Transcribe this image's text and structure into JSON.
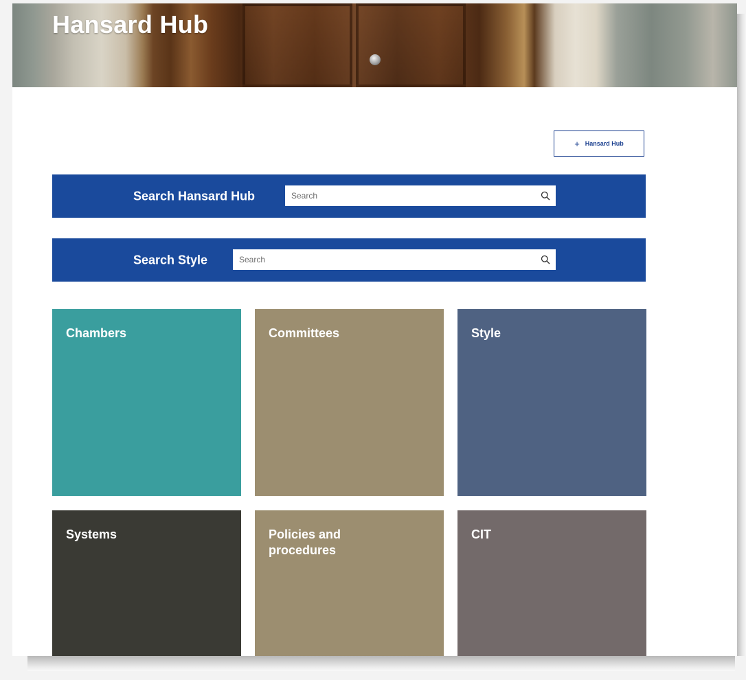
{
  "header": {
    "title": "Hansard Hub"
  },
  "toolbar": {
    "add_button_label": "Hansard Hub",
    "add_icon": "plus-icon"
  },
  "search_hub": {
    "label": "Search Hansard Hub",
    "placeholder": "Search",
    "icon": "search-icon"
  },
  "search_style": {
    "label": "Search Style",
    "placeholder": "Search",
    "icon": "search-icon"
  },
  "tiles": [
    {
      "label": "Chambers",
      "color": "#3a9e9e"
    },
    {
      "label": "Committees",
      "color": "#9c8e70"
    },
    {
      "label": "Style",
      "color": "#4f6282"
    },
    {
      "label": "Systems",
      "color": "#3a3a34"
    },
    {
      "label": "Policies and\nprocedures",
      "color": "#9c8e70"
    },
    {
      "label": "CIT",
      "color": "#736a6a"
    }
  ],
  "colors": {
    "search_bar": "#1a4a9c",
    "button_border": "#1a3f8f",
    "page_background": "#ffffff"
  }
}
